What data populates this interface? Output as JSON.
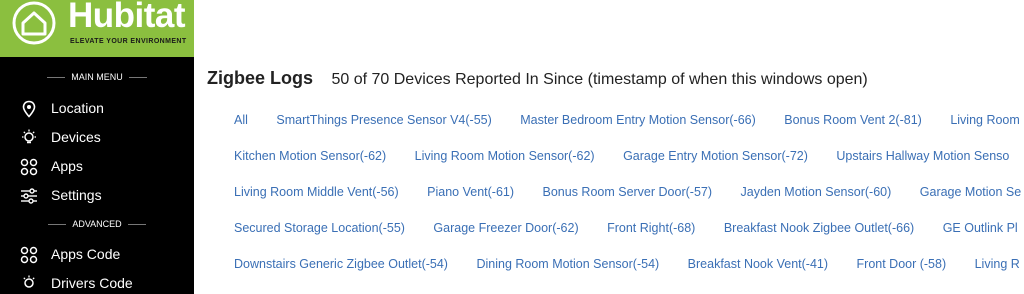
{
  "brand": {
    "name": "Hubitat",
    "tm": "™",
    "tagline": "ELEVATE YOUR ENVIRONMENT"
  },
  "sidebar": {
    "main_heading": "MAIN MENU",
    "main_items": [
      {
        "label": "Location",
        "icon": "location-pin-icon"
      },
      {
        "label": "Devices",
        "icon": "lightbulb-icon"
      },
      {
        "label": "Apps",
        "icon": "apps-icon"
      },
      {
        "label": "Settings",
        "icon": "sliders-icon"
      }
    ],
    "advanced_heading": "ADVANCED",
    "advanced_items": [
      {
        "label": "Apps Code",
        "icon": "apps-code-icon"
      },
      {
        "label": "Drivers Code",
        "icon": "drivers-code-icon"
      }
    ]
  },
  "main": {
    "title": "Zigbee Logs",
    "subtitle": "50 of 70 Devices Reported In Since (timestamp of when this windows open)",
    "filter_rows": [
      [
        "All",
        "SmartThings Presence Sensor V4(-55)",
        "Master Bedroom Entry Motion Sensor(-66)",
        "Bonus Room Vent 2(-81)",
        "Living Room"
      ],
      [
        "Kitchen Motion Sensor(-62)",
        "Living Room Motion Sensor(-62)",
        "Garage Entry Motion Sensor(-72)",
        "Upstairs Hallway Motion Senso"
      ],
      [
        "Living Room Middle Vent(-56)",
        "Piano Vent(-61)",
        "Bonus Room Server Door(-57)",
        "Jayden Motion Sensor(-60)",
        "Garage Motion Se"
      ],
      [
        "Secured Storage Location(-55)",
        "Garage Freezer Door(-62)",
        "Front Right(-68)",
        "Breakfast Nook Zigbee Outlet(-66)",
        "GE Outlink Pl"
      ],
      [
        "Downstairs Generic Zigbee Outlet(-54)",
        "Dining Room Motion Sensor(-54)",
        "Breakfast Nook Vent(-41)",
        "Front Door (-58)",
        "Living R"
      ]
    ]
  },
  "colors": {
    "brand_green": "#8bbf3f",
    "sidebar_bg": "#000000",
    "link": "#3a6fb5"
  }
}
